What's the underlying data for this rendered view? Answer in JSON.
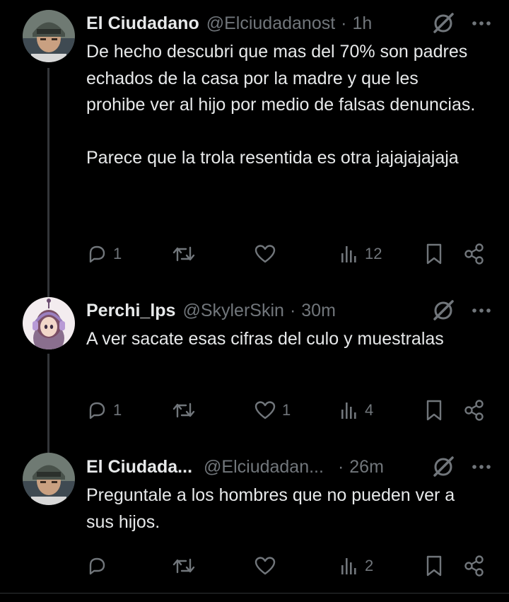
{
  "tweets": [
    {
      "name": "El Ciudadano",
      "handle": "@Elciudadanost",
      "time": "1h",
      "text": "De hecho descubri que mas del 70% son padres echados de la casa por la madre y que les prohibe ver al hijo por medio de falsas denuncias.\n\nParece que la trola resentida es otra jajajajajaja",
      "replies": "1",
      "reposts": "",
      "likes": "",
      "views": "12",
      "avatar": "soldier-helmet-avatar"
    },
    {
      "name": "Perchi_lps",
      "handle": "@SkylerSkin",
      "time": "30m",
      "text": "A ver sacate esas cifras del culo y muestralas",
      "replies": "1",
      "reposts": "",
      "likes": "1",
      "views": "4",
      "avatar": "cartoon-girl-headphones-avatar"
    },
    {
      "name": "El Ciudada...",
      "handle": "@Elciudadan...",
      "time": "26m",
      "text": "Preguntale a los hombres que no pueden ver a sus hijos.",
      "replies": "",
      "reposts": "",
      "likes": "",
      "views": "2",
      "avatar": "soldier-helmet-avatar"
    }
  ],
  "separator": "·",
  "colors": {
    "background": "#000000",
    "text": "#e7e9ea",
    "muted": "#71767b",
    "thread_line": "#333639"
  }
}
